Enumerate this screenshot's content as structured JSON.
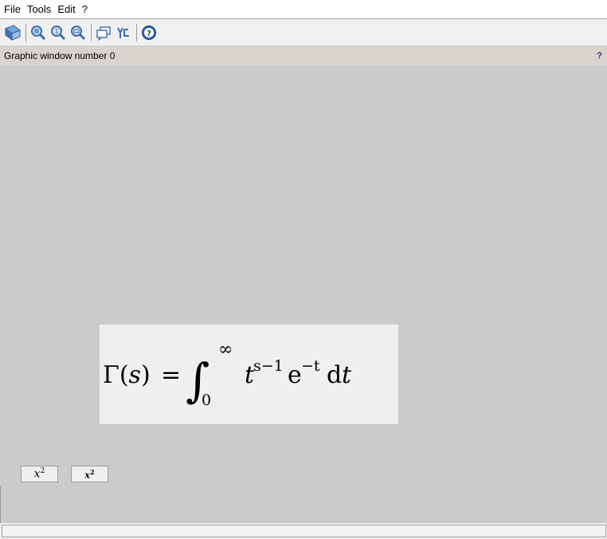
{
  "menu": [
    "File",
    "Tools",
    "Edit",
    "?"
  ],
  "toolbar": {
    "icons": [
      "rotate-icon",
      "zoom-in-icon",
      "zoom-original-icon",
      "zoom-area-icon",
      "datatip-icon",
      "datatip-manager-icon",
      "help-icon"
    ]
  },
  "info": {
    "title": "Graphic window number 0",
    "help": "?"
  },
  "formula": {
    "gamma": "Γ",
    "s": "s",
    "paren_open": "(",
    "paren_close": ")",
    "equals": "=",
    "integral": "∫",
    "upper": "∞",
    "lower": "0",
    "t": "t",
    "exp1": "s−1",
    "e": "e",
    "exp2": "−t",
    "d": "d",
    "t2": "t"
  },
  "buttons": {
    "latex": {
      "base": "x",
      "sup": "2"
    },
    "mathml": {
      "base": "x",
      "sup": "2"
    }
  },
  "colors": {
    "canvas": "#cbcbcb",
    "infobar": "#d7d4cd",
    "formula_bg": "#efefef"
  }
}
